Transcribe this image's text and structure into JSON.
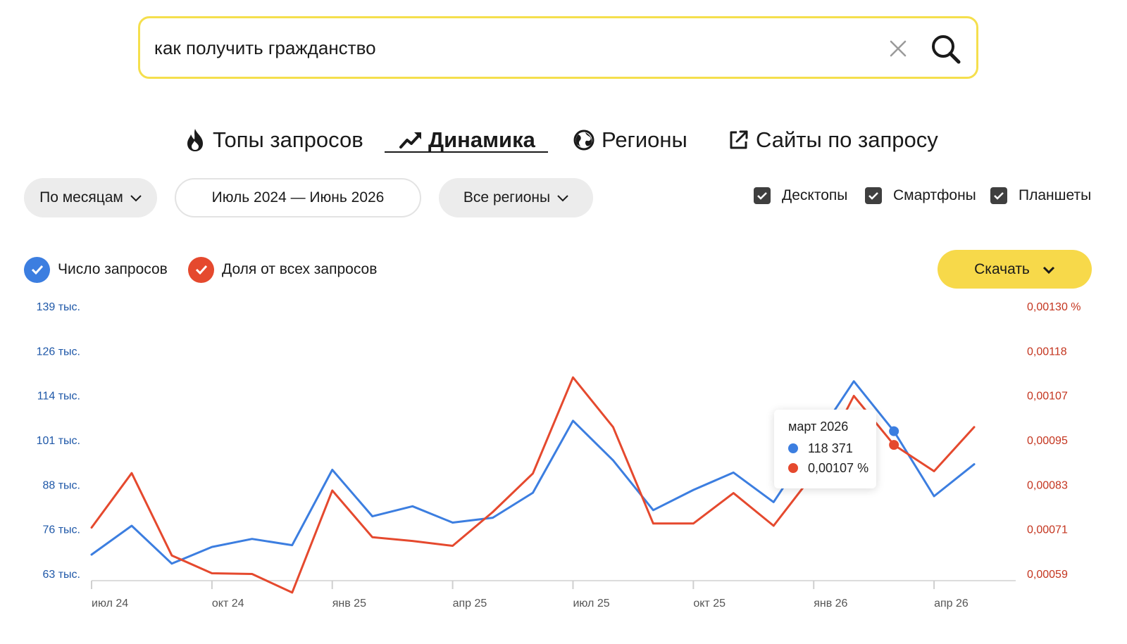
{
  "search": {
    "value": "как получить гражданство"
  },
  "tabs": [
    {
      "label": "Топы запросов",
      "icon": "fire-icon"
    },
    {
      "label": "Динамика",
      "icon": "trend-icon",
      "active": true
    },
    {
      "label": "Регионы",
      "icon": "globe-icon"
    },
    {
      "label": "Сайты по запросу",
      "icon": "external-link-icon"
    }
  ],
  "filters": {
    "period": "По месяцам",
    "range": "Июль 2024 — Июнь 2026",
    "region": "Все регионы"
  },
  "devices": [
    {
      "label": "Десктопы",
      "checked": true
    },
    {
      "label": "Смартфоны",
      "checked": true
    },
    {
      "label": "Планшеты",
      "checked": true
    }
  ],
  "series_toggles": [
    {
      "label": "Число запросов",
      "color": "#3c7ee0",
      "checked": true
    },
    {
      "label": "Доля от всех запросов",
      "color": "#e5492e",
      "checked": true
    }
  ],
  "download_label": "Скачать",
  "colors": {
    "blue": "#3c7ee0",
    "red": "#e5492e",
    "accent_yellow": "#f7d94a"
  },
  "tooltip": {
    "title": "март 2026",
    "count": "118 371",
    "share": "0,00107 %"
  },
  "chart_data": {
    "type": "line",
    "x": [
      "2024-07",
      "2024-08",
      "2024-09",
      "2024-10",
      "2024-11",
      "2024-12",
      "2025-01",
      "2025-02",
      "2025-03",
      "2025-04",
      "2025-05",
      "2025-06",
      "2025-07",
      "2025-08",
      "2025-09",
      "2025-10",
      "2025-11",
      "2025-12",
      "2026-01",
      "2026-02",
      "2026-03",
      "2026-04",
      "2026-05",
      "2026-06"
    ],
    "x_tick_labels": [
      "июл 24",
      "окт 24",
      "янв 25",
      "апр 25",
      "июл 25",
      "окт 25",
      "янв 26",
      "апр 26"
    ],
    "y_left": {
      "ylim": [
        61000,
        142000
      ],
      "tick_labels": [
        "139 тыс.",
        "126 тыс.",
        "114 тыс.",
        "101 тыс.",
        "88 тыс.",
        "76 тыс.",
        "63 тыс."
      ]
    },
    "y_right": {
      "ylim": [
        0.000572,
        0.001331
      ],
      "tick_labels": [
        "0,00130 %",
        "0,00118",
        "0,00107",
        "0,00095",
        "0,00083",
        "0,00071",
        "0,00059"
      ]
    },
    "series": [
      {
        "name": "Число запросов",
        "axis": "left",
        "color": "#3c7ee0",
        "values": [
          68500,
          76800,
          65900,
          70700,
          73000,
          71200,
          92900,
          79500,
          82400,
          77700,
          79100,
          86300,
          107000,
          95600,
          81300,
          87100,
          92100,
          83600,
          101000,
          118371,
          104000,
          85300,
          94500,
          null
        ]
      },
      {
        "name": "Доля от всех запросов",
        "axis": "right",
        "color": "#e5492e",
        "values": [
          0.000715,
          0.000862,
          0.00064,
          0.000592,
          0.00059,
          0.00054,
          0.000815,
          0.000689,
          0.000679,
          0.000666,
          0.000757,
          0.000861,
          0.00112,
          0.000986,
          0.000726,
          0.000726,
          0.000808,
          0.00072,
          0.00086,
          0.00107,
          0.000938,
          0.000867,
          0.000986,
          null
        ]
      }
    ]
  }
}
